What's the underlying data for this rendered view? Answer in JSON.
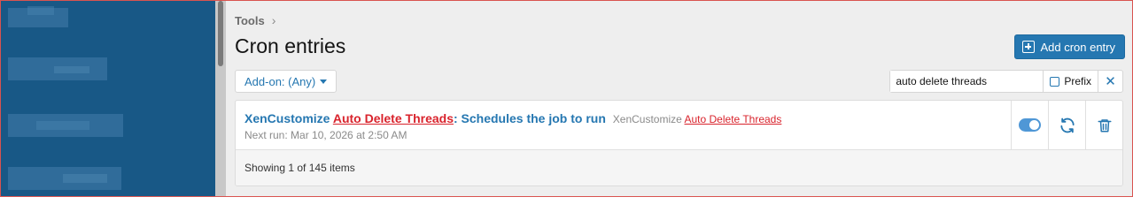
{
  "breadcrumb": {
    "label": "Tools"
  },
  "page": {
    "title": "Cron entries",
    "add_button_label": "Add cron entry"
  },
  "filters": {
    "addon_label": "Add-on: (Any)",
    "search_value": "auto delete threads",
    "prefix_label": "Prefix"
  },
  "entries": [
    {
      "title_prefix": "XenCustomize ",
      "title_highlight": "Auto Delete Threads",
      "title_suffix": ": Schedules the job to run",
      "addon_prefix": "XenCustomize ",
      "addon_highlight": "Auto Delete Threads",
      "next_run": "Next run: Mar 10, 2026 at 2:50 AM",
      "enabled": true
    }
  ],
  "footer": {
    "status": "Showing 1 of 145 items"
  },
  "icons": {
    "add": "plus-square-icon",
    "caret": "caret-down-icon",
    "clear": "close-icon",
    "rerun": "refresh-icon",
    "delete": "trash-icon"
  },
  "colors": {
    "accent": "#2577b1",
    "sidebar": "#185886",
    "highlight": "#d9232c",
    "toggle_on": "#4f97d6"
  }
}
